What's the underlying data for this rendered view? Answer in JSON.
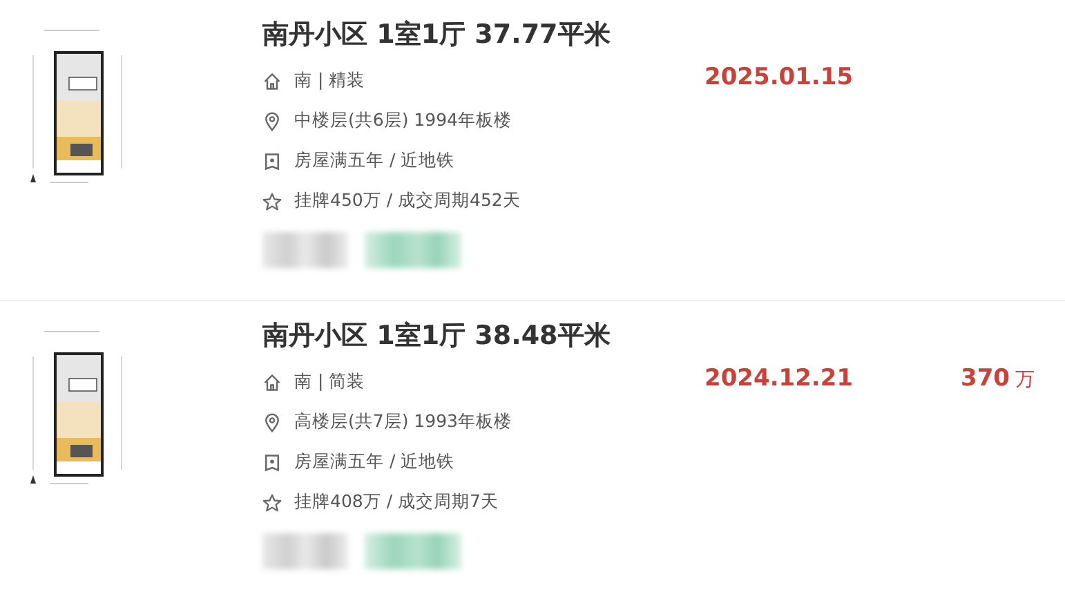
{
  "listings": [
    {
      "title": "南丹小区 1室1厅 37.77平米",
      "details": [
        {
          "kind": "house",
          "text": "南 | 精装"
        },
        {
          "kind": "location",
          "text": "中楼层(共6层) 1994年板楼"
        },
        {
          "kind": "badge",
          "text": "房屋满五年 / 近地铁"
        },
        {
          "kind": "star",
          "text": "挂牌450万 / 成交周期452天"
        }
      ],
      "deal_date": "2025.01.15"
    },
    {
      "title": "南丹小区 1室1厅 38.48平米",
      "details": [
        {
          "kind": "house",
          "text": "南 | 简装"
        },
        {
          "kind": "location",
          "text": "高楼层(共7层) 1993年板楼"
        },
        {
          "kind": "badge",
          "text": "房屋满五年 / 近地铁"
        },
        {
          "kind": "star",
          "text": "挂牌408万 / 成交周期7天"
        }
      ],
      "deal_date": "2024.12.21",
      "price": "370",
      "price_unit": "万"
    }
  ]
}
